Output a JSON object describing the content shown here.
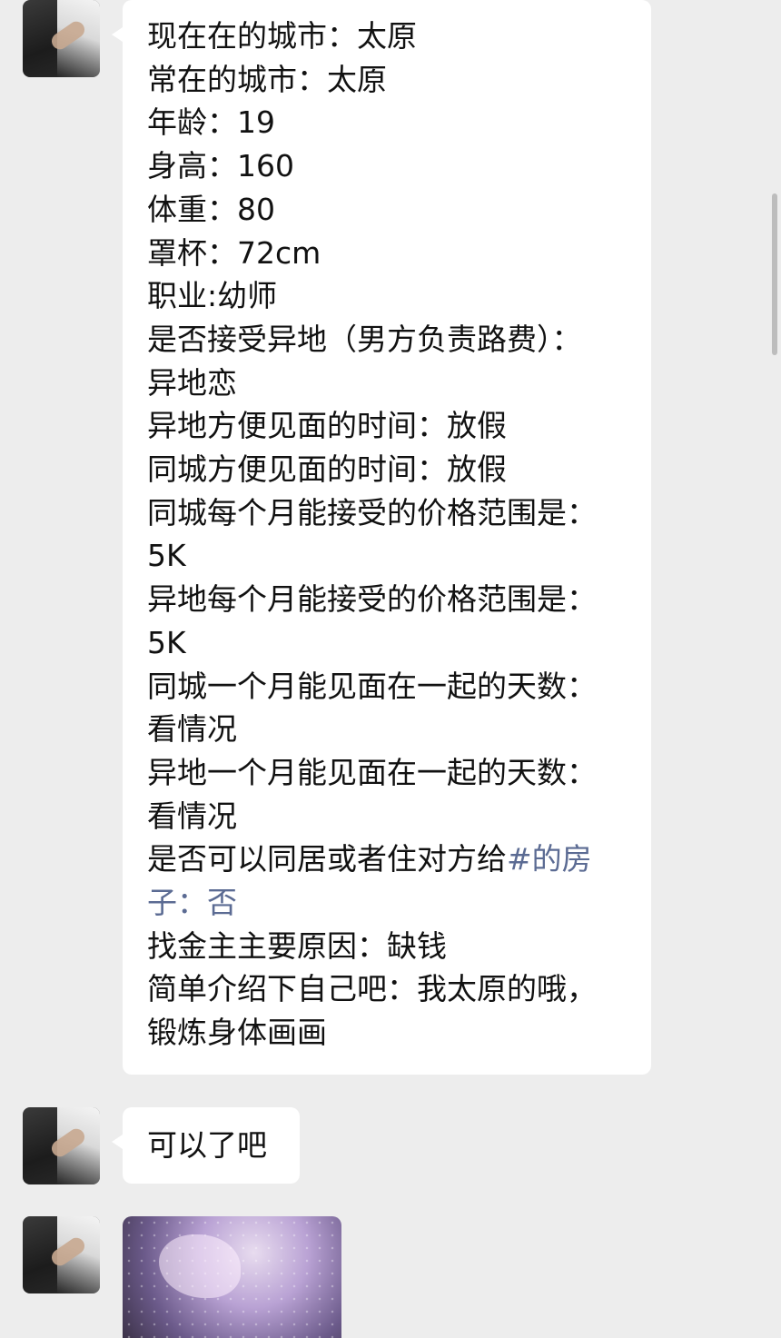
{
  "messages": {
    "profile_lines": [
      "现在在的城市：太原",
      "常在的城市：太原",
      "年龄：19",
      "身高：160",
      "体重：80",
      "罩杯：72cm",
      "职业:幼师",
      "是否接受异地（男方负责路费）：",
      "异地恋",
      "异地方便见面的时间：放假",
      "同城方便见面的时间：放假",
      "同城每个月能接受的价格范围是：",
      "5K",
      "异地每个月能接受的价格范围是：",
      "5K",
      "同城一个月能见面在一起的天数：",
      "看情况",
      "异地一个月能见面在一起的天数：",
      "看情况"
    ],
    "cohabit_prefix": "是否可以同居或者住对方给",
    "cohabit_link": "#的房",
    "cohabit_link_cont": "子：否",
    "profile_tail_lines": [
      "找金主主要原因：缺钱",
      "简单介绍下自己吧：我太原的哦，",
      "锻炼身体画画"
    ],
    "short_reply": "可以了吧"
  },
  "colors": {
    "background": "#ededed",
    "bubble": "#ffffff",
    "text": "#111111",
    "link": "#5b6b93"
  }
}
